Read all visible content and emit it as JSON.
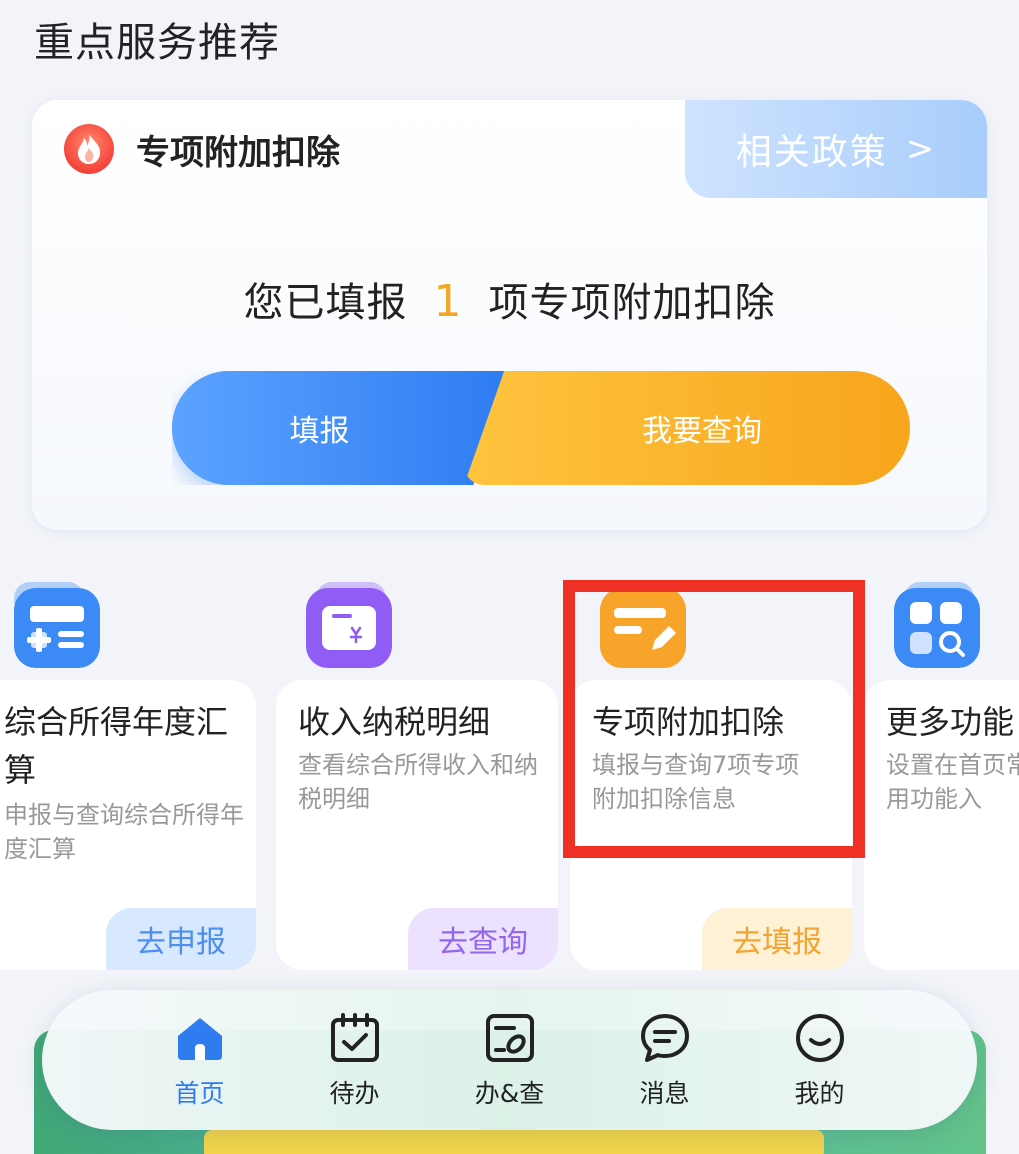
{
  "section_title": "重点服务推荐",
  "main_card": {
    "title": "专项附加扣除",
    "policy_link": "相关政策",
    "policy_chevron": ">",
    "summary_prefix": "您已填报",
    "summary_count": "1",
    "summary_suffix": "项专项附加扣除",
    "fill_button": "填报",
    "query_button": "我要查询"
  },
  "features": [
    {
      "title": "综合所得年度汇算",
      "desc": "申报与查询综合所得年度汇算",
      "action": "去申报",
      "color": "#3b8af5",
      "action_bg": "#d7e8ff",
      "action_color": "#4d8fee"
    },
    {
      "title": "收入纳税明细",
      "desc": "查看综合所得收入和纳税明细",
      "action": "去查询",
      "color": "#8f5cf5",
      "action_bg": "#ece2ff",
      "action_color": "#9466ee"
    },
    {
      "title": "专项附加扣除",
      "desc": "填报与查询7项专项附加扣除信息",
      "action": "去填报",
      "color": "#f8a32a",
      "action_bg": "#fff1d6",
      "action_color": "#f0a532"
    },
    {
      "title": "更多功能",
      "desc": "设置在首页常用功能入",
      "action": "",
      "color": "#3b8af5",
      "action_bg": "#d7e8ff",
      "action_color": "#4d8fee"
    }
  ],
  "bottom_nav": [
    {
      "label": "首页",
      "icon": "home-icon",
      "active": true
    },
    {
      "label": "待办",
      "icon": "calendar-check-icon",
      "active": false
    },
    {
      "label": "办&查",
      "icon": "document-pen-icon",
      "active": false
    },
    {
      "label": "消息",
      "icon": "chat-bubble-icon",
      "active": false
    },
    {
      "label": "我的",
      "icon": "smiley-icon",
      "active": false
    }
  ],
  "colors": {
    "accent_blue": "#2f7bf0",
    "accent_orange": "#f7a51c",
    "highlight_red": "#ee3124"
  }
}
